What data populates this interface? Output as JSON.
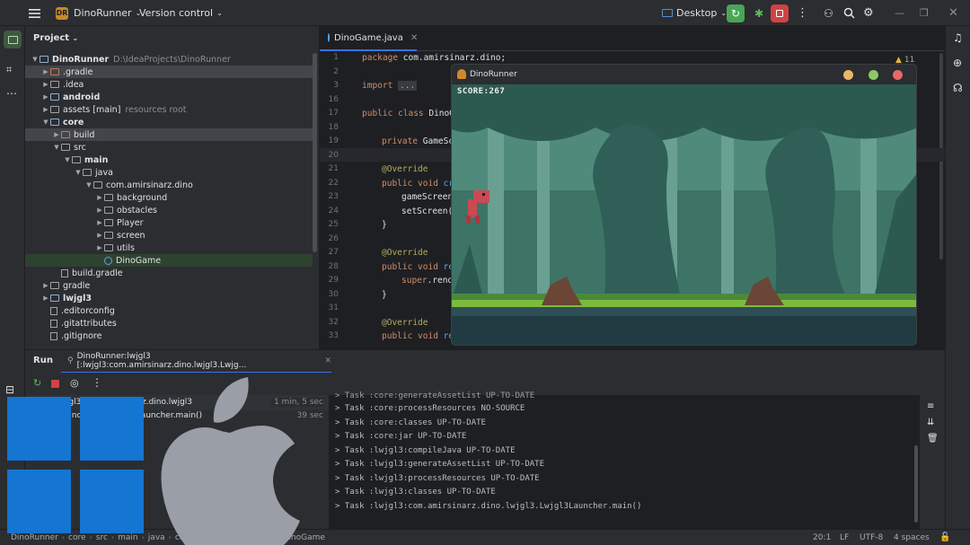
{
  "titlebar": {
    "project_badge": "DR",
    "project_name": "DinoRunner",
    "vcs": "Version control",
    "run_config": "Desktop",
    "colors": {
      "run": "#4aa657",
      "stop": "#d04343"
    }
  },
  "project": {
    "header": "Project",
    "items": [
      {
        "label": "DinoRunner",
        "hint": "D:\\IdeaProjects\\DinoRunner",
        "depth": 0,
        "open": true,
        "type": "module",
        "bold": true
      },
      {
        "label": ".gradle",
        "depth": 1,
        "open": false,
        "type": "excluded",
        "selected": true
      },
      {
        "label": ".idea",
        "depth": 1,
        "open": false,
        "type": "folder"
      },
      {
        "label": "android",
        "depth": 1,
        "open": false,
        "type": "module",
        "bold": true
      },
      {
        "label": "assets [main]",
        "hint": "resources root",
        "depth": 1,
        "open": false,
        "type": "folder"
      },
      {
        "label": "core",
        "depth": 1,
        "open": true,
        "type": "module",
        "bold": true
      },
      {
        "label": "build",
        "depth": 2,
        "open": false,
        "type": "excluded",
        "selected": true
      },
      {
        "label": "src",
        "depth": 2,
        "open": true,
        "type": "folder"
      },
      {
        "label": "main",
        "depth": 3,
        "open": true,
        "type": "folder",
        "bold": true
      },
      {
        "label": "java",
        "depth": 4,
        "open": true,
        "type": "folder"
      },
      {
        "label": "com.amirsinarz.dino",
        "depth": 5,
        "open": true,
        "type": "package"
      },
      {
        "label": "background",
        "depth": 6,
        "open": false,
        "type": "package"
      },
      {
        "label": "obstacles",
        "depth": 6,
        "open": false,
        "type": "package"
      },
      {
        "label": "Player",
        "depth": 6,
        "open": false,
        "type": "package"
      },
      {
        "label": "screen",
        "depth": 6,
        "open": false,
        "type": "package"
      },
      {
        "label": "utils",
        "depth": 6,
        "open": false,
        "type": "package"
      },
      {
        "label": "DinoGame",
        "depth": 6,
        "leaf": true,
        "type": "class",
        "active": true
      },
      {
        "label": "build.gradle",
        "depth": 2,
        "leaf": true,
        "type": "gradle"
      },
      {
        "label": "gradle",
        "depth": 1,
        "open": false,
        "type": "folder"
      },
      {
        "label": "lwjgl3",
        "depth": 1,
        "open": false,
        "type": "module",
        "bold": true
      },
      {
        "label": ".editorconfig",
        "depth": 1,
        "leaf": true,
        "type": "config"
      },
      {
        "label": ".gitattributes",
        "depth": 1,
        "leaf": true,
        "type": "file"
      },
      {
        "label": ".gitignore",
        "depth": 1,
        "leaf": true,
        "type": "file"
      }
    ]
  },
  "editor": {
    "tab": "DinoGame.java",
    "inspection_count": "11",
    "line_numbers": [
      "1",
      "2",
      "3",
      "16",
      "17",
      "18",
      "19",
      "20",
      "21",
      "22",
      "23",
      "24",
      "25",
      "26",
      "27",
      "28",
      "29",
      "30",
      "31",
      "32",
      "33"
    ],
    "lines": [
      {
        "indent": 0,
        "parts": [
          [
            "kw",
            "package "
          ],
          [
            "",
            "com.amirsinarz.dino;"
          ]
        ]
      },
      {
        "indent": 0,
        "parts": []
      },
      {
        "indent": 0,
        "parts": [
          [
            "kw",
            "import "
          ],
          [
            "fold",
            "..."
          ]
        ]
      },
      {
        "indent": 0,
        "parts": []
      },
      {
        "indent": 0,
        "parts": [
          [
            "kw",
            "public class "
          ],
          [
            "",
            "DinoG"
          ]
        ]
      },
      {
        "indent": 0,
        "parts": []
      },
      {
        "indent": 1,
        "parts": [
          [
            "kw",
            "private "
          ],
          [
            "",
            "GameSc"
          ]
        ]
      },
      {
        "indent": 0,
        "parts": []
      },
      {
        "indent": 1,
        "parts": [
          [
            "ann",
            "@Override"
          ]
        ]
      },
      {
        "indent": 1,
        "parts": [
          [
            "kw",
            "public void "
          ],
          [
            "fn",
            "cr"
          ]
        ]
      },
      {
        "indent": 2,
        "parts": [
          [
            "",
            "gameScreen"
          ]
        ]
      },
      {
        "indent": 2,
        "parts": [
          [
            "",
            "setScreen("
          ]
        ]
      },
      {
        "indent": 1,
        "parts": [
          [
            "",
            "}"
          ]
        ]
      },
      {
        "indent": 0,
        "parts": []
      },
      {
        "indent": 1,
        "parts": [
          [
            "ann",
            "@Override"
          ]
        ]
      },
      {
        "indent": 1,
        "parts": [
          [
            "kw",
            "public void "
          ],
          [
            "fn",
            "re"
          ]
        ]
      },
      {
        "indent": 2,
        "parts": [
          [
            "kw",
            "super"
          ],
          [
            "",
            ".rend"
          ]
        ]
      },
      {
        "indent": 1,
        "parts": [
          [
            "",
            "}"
          ]
        ]
      },
      {
        "indent": 0,
        "parts": []
      },
      {
        "indent": 1,
        "parts": [
          [
            "ann",
            "@Override"
          ]
        ]
      },
      {
        "indent": 1,
        "parts": [
          [
            "kw",
            "public void "
          ],
          [
            "fn",
            "re"
          ]
        ]
      }
    ]
  },
  "game": {
    "title": "DinoRunner",
    "score": "SCORE:267",
    "dots": [
      "#e6b96b",
      "#8fc766",
      "#e86767"
    ]
  },
  "run": {
    "tab_label": "Run",
    "config_tab": "DinoRunner:lwjgl3 [:lwjgl3:com.amirsinarz.dino.lwjgl3.Lwjg...",
    "tree": [
      {
        "label": "lwjgl3:com.amirsinarz.dino.lwjgl3",
        "time": "1 min, 5 sec"
      },
      {
        "label": "z.dino.lwjgl3.Lwjgl3Launcher.main()",
        "time": "39 sec"
      }
    ],
    "console": [
      "> Task :core:processResources NO-SOURCE",
      "> Task :core:classes UP-TO-DATE",
      "> Task :core:jar UP-TO-DATE",
      "> Task :lwjgl3:compileJava UP-TO-DATE",
      "> Task :lwjgl3:generateAssetList UP-TO-DATE",
      "> Task :lwjgl3:processResources UP-TO-DATE",
      "> Task :lwjgl3:classes UP-TO-DATE",
      "> Task :lwjgl3:com.amirsinarz.dino.lwjgl3.Lwjgl3Launcher.main()"
    ]
  },
  "status": {
    "breadcrumbs": [
      "DinoRunner",
      "core",
      "src",
      "main",
      "java",
      "com",
      "amirsinarz",
      "dino",
      "DinoGame"
    ],
    "position": "20:1",
    "line_sep": "LF",
    "encoding": "UTF-8",
    "indent": "4 spaces"
  },
  "overlay": {
    "windows_color": "#1475d3",
    "apple_color": "#9a9ea6"
  }
}
